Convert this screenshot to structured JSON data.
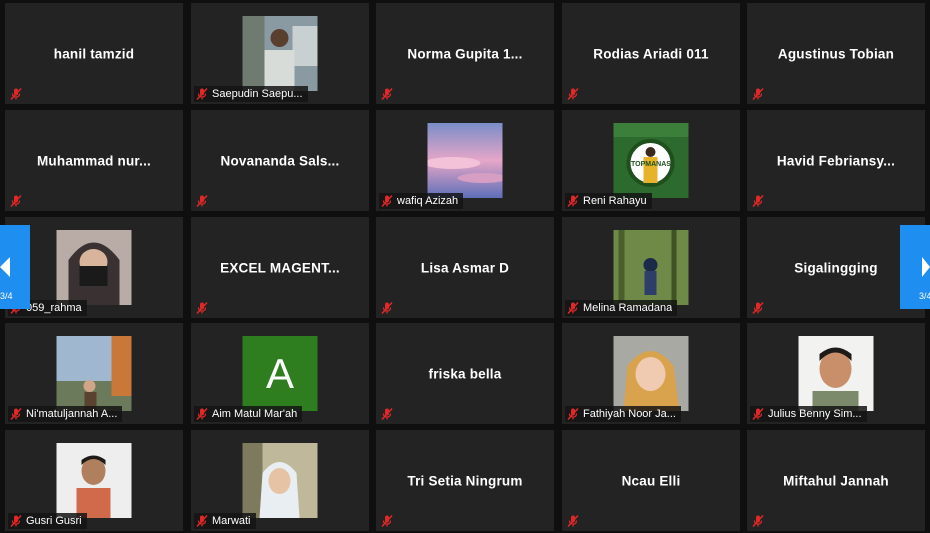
{
  "participants": [
    {
      "id": "p1",
      "name": "hanil tamzid",
      "video": false
    },
    {
      "id": "p2",
      "name": "Saepudin Saepu...",
      "video": true,
      "icon": "person-outdoor-photo"
    },
    {
      "id": "p3",
      "name": "Norma Gupita 1...",
      "video": false
    },
    {
      "id": "p4",
      "name": "Rodias Ariadi 011",
      "video": false
    },
    {
      "id": "p5",
      "name": "Agustinus Tobian",
      "video": false
    },
    {
      "id": "p6",
      "name": "Muhammad nur...",
      "video": false
    },
    {
      "id": "p7",
      "name": "Novananda Sals...",
      "video": false
    },
    {
      "id": "p8",
      "name": "wafiq Azizah",
      "video": true,
      "icon": "sky-clouds-photo"
    },
    {
      "id": "p9",
      "name": "Reni Rahayu",
      "video": true,
      "icon": "event-logo-photo",
      "photo_caption": "TOPMANAS"
    },
    {
      "id": "p10",
      "name": "Havid Febriansy...",
      "video": false
    },
    {
      "id": "p11",
      "name": "059_rahma",
      "video": true,
      "icon": "person-masked-photo"
    },
    {
      "id": "p12",
      "name": "EXCEL MAGENT...",
      "video": false
    },
    {
      "id": "p13",
      "name": "Lisa Asmar D",
      "video": false
    },
    {
      "id": "p14",
      "name": "Melina Ramadana",
      "video": true,
      "icon": "person-forest-photo"
    },
    {
      "id": "p15",
      "name": "Sigalingging",
      "video": false
    },
    {
      "id": "p16",
      "name": "Ni'matuljannah A...",
      "video": true,
      "icon": "person-park-photo"
    },
    {
      "id": "p17",
      "name": "Aim Matul Mar'ah",
      "video": true,
      "icon": "letter-avatar",
      "avatar_letter": "A",
      "avatar_color": "#2e7d1f"
    },
    {
      "id": "p18",
      "name": "friska bella",
      "video": false
    },
    {
      "id": "p19",
      "name": "Fathiyah Noor Ja...",
      "video": true,
      "icon": "person-hijab-photo"
    },
    {
      "id": "p20",
      "name": "Julius Benny Sim...",
      "video": true,
      "icon": "person-smiling-photo"
    },
    {
      "id": "p21",
      "name": "Gusri Gusri",
      "video": true,
      "icon": "person-portrait-photo"
    },
    {
      "id": "p22",
      "name": "Marwati",
      "video": true,
      "icon": "person-hijab-outdoor-photo"
    },
    {
      "id": "p23",
      "name": "Tri Setia Ningrum",
      "video": false
    },
    {
      "id": "p24",
      "name": "Ncau Elli",
      "video": false
    },
    {
      "id": "p25",
      "name": "Miftahul Jannah",
      "video": false
    }
  ],
  "navigation": {
    "prev_page": "3/4",
    "next_page": "3/4"
  },
  "colors": {
    "tile_bg": "#232323",
    "muted_mic": "#e02828",
    "nav_accent": "#1f8ef1"
  }
}
